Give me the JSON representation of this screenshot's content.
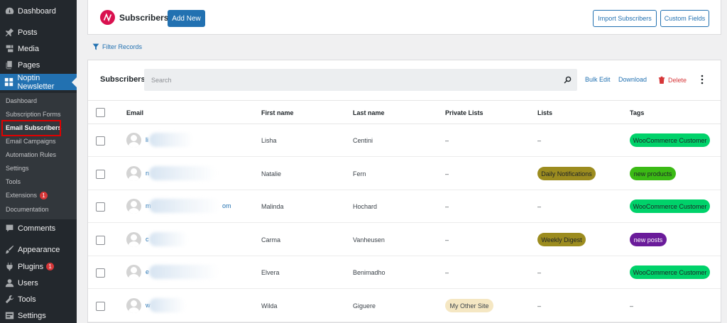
{
  "sidebar": {
    "items": [
      {
        "label": "Dashboard",
        "icon": "dashboard-icon"
      },
      {
        "label": "Posts",
        "icon": "pin-icon"
      },
      {
        "label": "Media",
        "icon": "media-icon"
      },
      {
        "label": "Pages",
        "icon": "pages-icon"
      },
      {
        "label": "Noptin Newsletter",
        "icon": "noptin-icon"
      },
      {
        "label": "Comments",
        "icon": "comments-icon"
      },
      {
        "label": "Appearance",
        "icon": "brush-icon"
      },
      {
        "label": "Plugins",
        "icon": "plugin-icon",
        "badge": "1"
      },
      {
        "label": "Users",
        "icon": "users-icon"
      },
      {
        "label": "Tools",
        "icon": "wrench-icon"
      },
      {
        "label": "Settings",
        "icon": "settings-icon"
      }
    ],
    "submenu": [
      {
        "label": "Dashboard"
      },
      {
        "label": "Subscription Forms"
      },
      {
        "label": "Email Subscribers"
      },
      {
        "label": "Email Campaigns"
      },
      {
        "label": "Automation Rules"
      },
      {
        "label": "Settings"
      },
      {
        "label": "Tools"
      },
      {
        "label": "Extensions",
        "badge": "1"
      },
      {
        "label": "Documentation"
      }
    ]
  },
  "header": {
    "title": "Subscribers",
    "add_new": "Add New",
    "import": "Import Subscribers",
    "custom_fields": "Custom Fields"
  },
  "filter_label": "Filter Records",
  "table_card": {
    "title": "Subscribers",
    "search_placeholder": "Search",
    "bulk_edit": "Bulk Edit",
    "download": "Download",
    "delete": "Delete"
  },
  "columns": [
    "Email",
    "First name",
    "Last name",
    "Private Lists",
    "Lists",
    "Tags"
  ],
  "rows": [
    {
      "email_start": "li",
      "email_end": "",
      "first": "Lisha",
      "last": "Centini",
      "private": "–",
      "lists": "–",
      "tags": "WooCommerce Customer"
    },
    {
      "email_start": "n",
      "email_end": "",
      "first": "Natalie",
      "last": "Fern",
      "private": "–",
      "lists": "Daily Notifications",
      "tags": "new products"
    },
    {
      "email_start": "m",
      "email_end": "om",
      "first": "Malinda",
      "last": "Hochard",
      "private": "–",
      "lists": "–",
      "tags": "WooCommerce Customer"
    },
    {
      "email_start": "c",
      "email_end": "",
      "first": "Carma",
      "last": "Vanheusen",
      "private": "–",
      "lists": "Weekly Digest",
      "tags": "new posts"
    },
    {
      "email_start": "e",
      "email_end": "",
      "first": "Elvera",
      "last": "Benimadho",
      "private": "–",
      "lists": "–",
      "tags": "WooCommerce Customer"
    },
    {
      "email_start": "w",
      "email_end": "",
      "first": "Wilda",
      "last": "Giguere",
      "private": "My Other Site",
      "lists": "–",
      "tags": "–"
    }
  ],
  "colors": {
    "accent": "#2271b1",
    "sidebar": "#23282d",
    "brand": "#d9114f",
    "tag_green": "#00d26a",
    "tag_lime": "#3bba15",
    "tag_purple": "#6a1b9a",
    "list_olive": "#9c8c1f",
    "private_beige": "#f5e7c3"
  }
}
